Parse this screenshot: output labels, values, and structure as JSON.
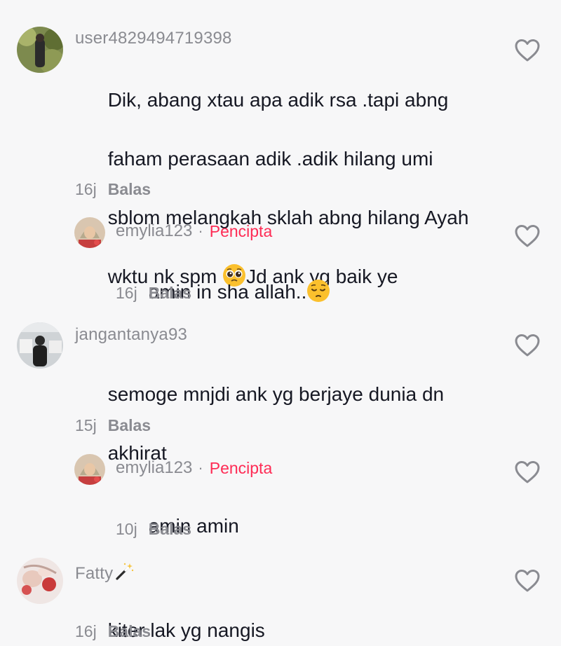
{
  "comments": [
    {
      "username": "user4829494719398",
      "text_lines": [
        "Dik, abang xtau apa adik rsa .tapi abng",
        "faham perasaan adik .adik hilang umi",
        "sblom melangkah sklah abng hilang Ayah"
      ],
      "text_last_before": "wktu nk spm ",
      "text_last_after": "Jd ank yg baik ye",
      "emoji": "pleading-face-emoji",
      "time": "16j",
      "reply_label": "Balas",
      "like_icon": "heart-outline-icon"
    },
    {
      "username": "emylia123",
      "separator": "·",
      "creator_badge": "Pencipta",
      "text": "amin in sha allah..",
      "emoji": "pensive-face-emoji",
      "time": "16j",
      "reply_label": "Balas",
      "like_icon": "heart-outline-icon"
    },
    {
      "username": "jangantanya93",
      "text_lines": [
        "semoge mnjdi ank yg berjaye dunia dn",
        "akhirat"
      ],
      "time": "15j",
      "reply_label": "Balas",
      "like_icon": "heart-outline-icon"
    },
    {
      "username": "emylia123",
      "separator": "·",
      "creator_badge": "Pencipta",
      "text": "amin amin",
      "time": "10j",
      "reply_label": "Balas",
      "like_icon": "heart-outline-icon"
    },
    {
      "username": "Fatty",
      "username_icon": "magic-wand-emoji",
      "text": "kiter lak yg nangis",
      "time": "16j",
      "reply_label": "Balas",
      "like_icon": "heart-outline-icon"
    }
  ],
  "colors": {
    "background": "#f7f7f8",
    "text": "#161823",
    "secondary": "#8a8b91",
    "creator_badge": "#fe2c55"
  }
}
